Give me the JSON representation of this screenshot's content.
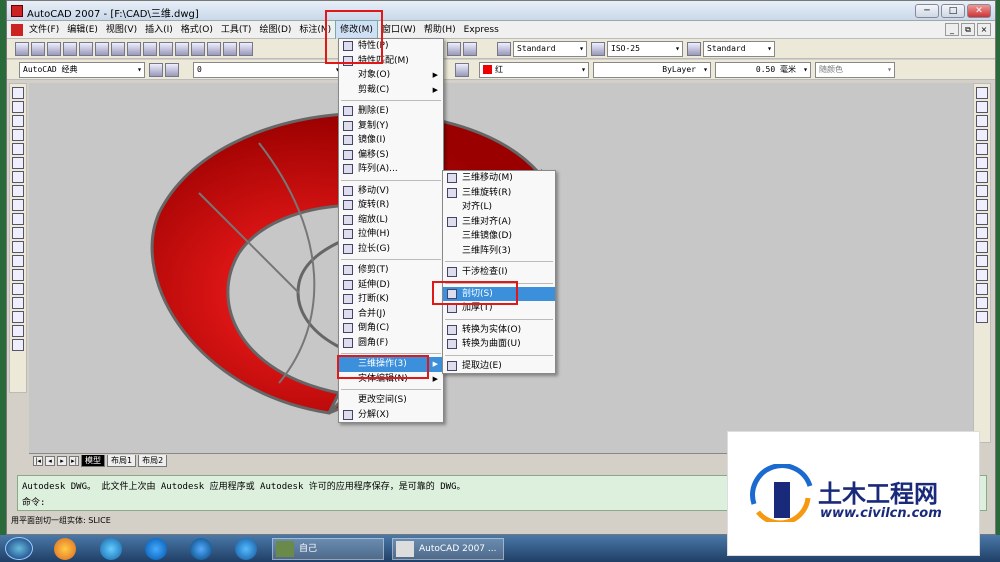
{
  "window": {
    "title": "AutoCAD 2007 - [F:\\CAD\\三维.dwg]",
    "min": "─",
    "max": "□",
    "close": "✕"
  },
  "menubar": {
    "items": [
      "文件(F)",
      "编辑(E)",
      "视图(V)",
      "插入(I)",
      "格式(O)",
      "工具(T)",
      "绘图(D)",
      "标注(N)",
      "修改(M)",
      "窗口(W)",
      "帮助(H)",
      "Express"
    ],
    "active": "修改(M)"
  },
  "toolbar1": {
    "text_style": "Standard",
    "dim_style": "ISO-25",
    "table_style": "Standard"
  },
  "toolbar2": {
    "workspace": "AutoCAD 经典",
    "layer": "0",
    "color": "红",
    "linetype": "ByLayer",
    "lineweight": "0.50 毫米",
    "plotstyle": "随颜色"
  },
  "tabs": {
    "model": "模型",
    "layout1": "布局1",
    "layout2": "布局2"
  },
  "command": {
    "line1": "Autodesk DWG。  此文件上次由 Autodesk 应用程序或 Autodesk 许可的应用程序保存，是可靠的 DWG。",
    "prompt": "命令:",
    "status": "用平面剖切一组实体:  SLICE"
  },
  "modify_menu": {
    "items": [
      "特性(P)",
      "特性匹配(M)",
      "对象(O)",
      "剪裁(C)",
      "删除(E)",
      "复制(Y)",
      "镜像(I)",
      "偏移(S)",
      "阵列(A)...",
      "移动(V)",
      "旋转(R)",
      "缩放(L)",
      "拉伸(H)",
      "拉长(G)",
      "修剪(T)",
      "延伸(D)",
      "打断(K)",
      "合并(J)",
      "倒角(C)",
      "圆角(F)",
      "三维操作(3)",
      "实体编辑(N)",
      "更改空间(S)",
      "分解(X)"
    ]
  },
  "ops3d_menu": {
    "items": [
      "三维移动(M)",
      "三维旋转(R)",
      "对齐(L)",
      "三维对齐(A)",
      "三维镜像(D)",
      "三维阵列(3)",
      "干涉检查(I)",
      "剖切(S)",
      "加厚(T)",
      "转换为实体(O)",
      "转换为曲面(U)",
      "提取边(E)"
    ],
    "highlighted": "剖切(S)"
  },
  "taskbar": {
    "task1": "自己",
    "task2": "AutoCAD 2007 ..."
  },
  "logo": {
    "name": "土木工程网",
    "url": "www.civilcn.com"
  },
  "colors": {
    "solid": "#e60000",
    "menu_highlight": "#3b8fdb",
    "callout": "#e01818"
  }
}
